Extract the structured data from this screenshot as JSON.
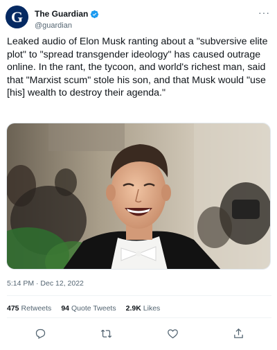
{
  "account": {
    "display_name": "The Guardian",
    "handle": "@guardian",
    "avatar_letter": "G",
    "verified_icon": "verified-badge-icon"
  },
  "menu": {
    "more_label": "···"
  },
  "tweet": {
    "text": "Leaked audio of Elon Musk ranting about a \"subversive elite plot\" to \"spread transgender ideology\" has caused outrage online. In the rant, the tycoon, and world's richest man, said that \"Marxist scum\" stole his son, and that Musk would \"use [his] wealth to destroy their agenda.\"",
    "timestamp": "5:14 PM · Dec 12, 2022"
  },
  "stats": {
    "retweets_count": "475",
    "retweets_label": "Retweets",
    "quotes_count": "94",
    "quotes_label": "Quote Tweets",
    "likes_count": "2.9K",
    "likes_label": "Likes"
  },
  "actions": [
    {
      "icon": "reply-icon"
    },
    {
      "icon": "retweet-icon"
    },
    {
      "icon": "like-icon"
    },
    {
      "icon": "share-icon"
    }
  ],
  "colors": {
    "brand": "#052962",
    "verified": "#1d9bf0",
    "secondary_text": "#536471",
    "primary_text": "#0f1419"
  }
}
